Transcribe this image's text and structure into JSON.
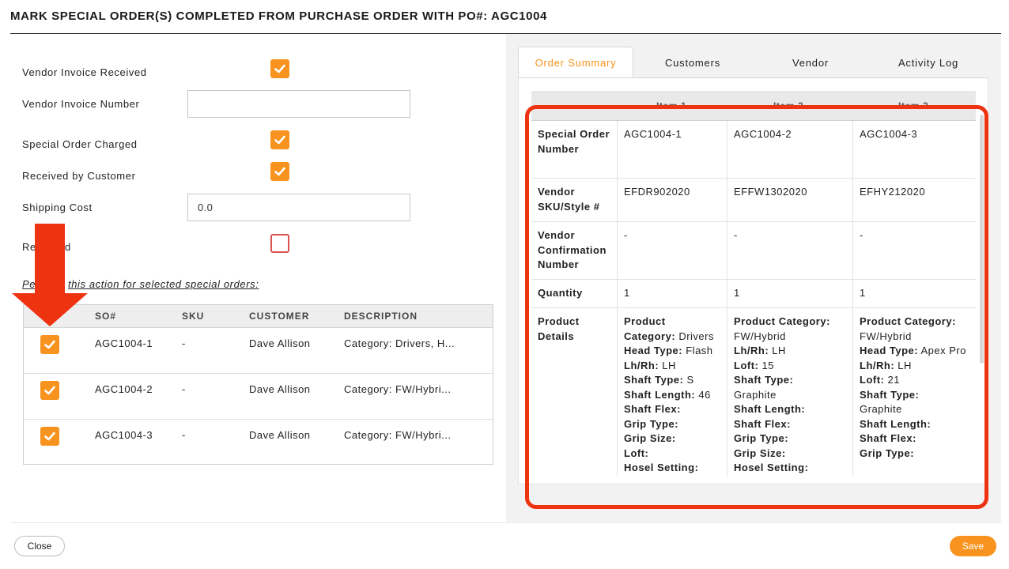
{
  "dialog": {
    "title": "MARK SPECIAL ORDER(S) COMPLETED FROM PURCHASE ORDER WITH PO#: AGC1004"
  },
  "form": {
    "vendor_invoice_received_label": "Vendor Invoice Received",
    "vendor_invoice_received_checked": true,
    "vendor_invoice_number_label": "Vendor Invoice Number",
    "vendor_invoice_number_value": "",
    "special_order_charged_label": "Special Order Charged",
    "special_order_charged_checked": true,
    "received_by_customer_label": "Received by Customer",
    "received_by_customer_checked": true,
    "shipping_cost_label": "Shipping Cost",
    "shipping_cost_value": "0.0",
    "returned_label_prefix": "Re",
    "returned_label_suffix": "d",
    "returned_checked": false
  },
  "perform": {
    "label_prefix": "Pe",
    "label_suffix": "this action for selected special orders:"
  },
  "so_table": {
    "headers": {
      "so": "SO#",
      "sku": "SKU",
      "customer": "CUSTOMER",
      "description": "DESCRIPTION"
    },
    "rows": [
      {
        "checked": true,
        "so": "AGC1004-1",
        "sku": "-",
        "customer": "Dave Allison",
        "description": "Category: Drivers, H..."
      },
      {
        "checked": true,
        "so": "AGC1004-2",
        "sku": "-",
        "customer": "Dave Allison",
        "description": "Category: FW/Hybri..."
      },
      {
        "checked": true,
        "so": "AGC1004-3",
        "sku": "-",
        "customer": "Dave Allison",
        "description": "Category: FW/Hybri..."
      }
    ]
  },
  "tabs": {
    "order_summary": "Order Summary",
    "customers": "Customers",
    "vendor": "Vendor",
    "activity_log": "Activity Log",
    "active": "order_summary"
  },
  "summary": {
    "headers": [
      "Item 1",
      "Item 2",
      "Item 3"
    ],
    "special_order_number_label": "Special Order Number",
    "special_order_numbers": [
      "AGC1004-1",
      "AGC1004-2",
      "AGC1004-3"
    ],
    "vendor_sku_label": "Vendor SKU/Style #",
    "vendor_skus": [
      "EFDR902020",
      "EFFW1302020",
      "EFHY212020"
    ],
    "vendor_confirmation_label": "Vendor Confirmation Number",
    "vendor_confirmations": [
      "-",
      "-",
      "-"
    ],
    "quantity_label": "Quantity",
    "quantities": [
      "1",
      "1",
      "1"
    ],
    "product_details_label": "Product Details",
    "product_details": [
      {
        "product_heading": "Product",
        "category_label": "Category:",
        "category": "Drivers",
        "head_type_label": "Head Type:",
        "head_type": "Flash",
        "lhrh_label": "Lh/Rh:",
        "lhrh": "LH",
        "shaft_type_label": "Shaft Type:",
        "shaft_type": "S",
        "shaft_length_label": "Shaft Length:",
        "shaft_length": "46",
        "shaft_flex_label": "Shaft Flex:",
        "grip_type_label": "Grip Type:",
        "grip_size_label": "Grip Size:",
        "loft_label": "Loft:",
        "hosel_label": "Hosel Setting:"
      },
      {
        "category_label": "Product Category:",
        "category": "FW/Hybrid",
        "lhrh_label": "Lh/Rh:",
        "lhrh": "LH",
        "loft_label": "Loft:",
        "loft": "15",
        "shaft_type_label": "Shaft Type:",
        "shaft_type": "Graphite",
        "shaft_length_label": "Shaft Length:",
        "shaft_flex_label": "Shaft Flex:",
        "grip_type_label": "Grip Type:",
        "grip_size_label": "Grip Size:",
        "hosel_label": "Hosel Setting:"
      },
      {
        "category_label": "Product Category:",
        "category": "FW/Hybrid",
        "head_type_label": "Head Type:",
        "head_type": "Apex Pro",
        "lhrh_label": "Lh/Rh:",
        "lhrh": "LH",
        "loft_label": "Loft:",
        "loft": "21",
        "shaft_type_label": "Shaft Type:",
        "shaft_type": "Graphite",
        "shaft_length_label": "Shaft Length:",
        "shaft_flex_label": "Shaft Flex:",
        "grip_type_label": "Grip Type:"
      }
    ]
  },
  "footer": {
    "close_label": "Close",
    "save_label": "Save"
  },
  "colors": {
    "accent": "#f7931e",
    "highlight": "#ee3311"
  }
}
